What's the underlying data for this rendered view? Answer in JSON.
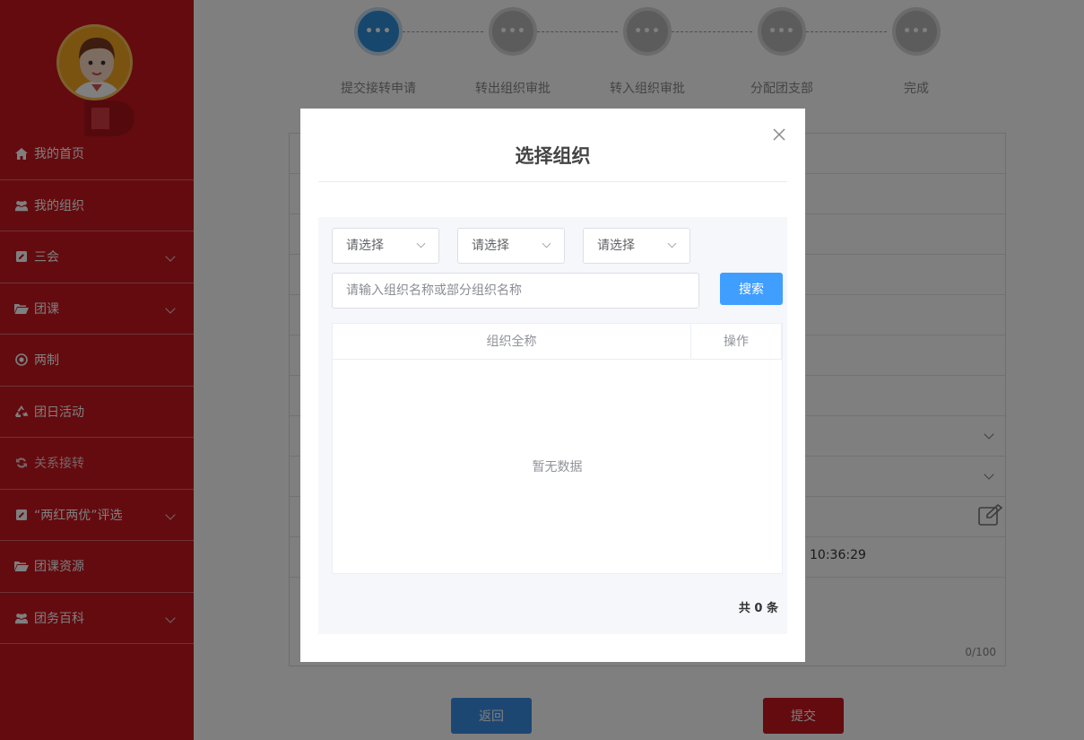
{
  "sidebar": {
    "items": [
      {
        "label": "我的首页",
        "icon": "home-icon",
        "has_submenu": false
      },
      {
        "label": "我的组织",
        "icon": "users-icon",
        "has_submenu": false
      },
      {
        "label": "三会",
        "icon": "edit-icon",
        "has_submenu": true
      },
      {
        "label": "团课",
        "icon": "folder-icon",
        "has_submenu": true
      },
      {
        "label": "两制",
        "icon": "target-icon",
        "has_submenu": false
      },
      {
        "label": "团日活动",
        "icon": "recycle-icon",
        "has_submenu": false
      },
      {
        "label": "关系接转",
        "icon": "refresh-icon",
        "has_submenu": false
      },
      {
        "label": "“两红两优”评选",
        "icon": "edit-icon",
        "has_submenu": true
      },
      {
        "label": "团课资源",
        "icon": "folder-icon",
        "has_submenu": false
      },
      {
        "label": "团务百科",
        "icon": "users-icon",
        "has_submenu": true
      }
    ]
  },
  "steps": {
    "items": [
      {
        "label": "提交接转申请",
        "icon": "•••"
      },
      {
        "label": "转出组织审批",
        "icon": "•••"
      },
      {
        "label": "转入组织审批",
        "icon": "•••"
      },
      {
        "label": "分配团支部",
        "icon": "•••"
      },
      {
        "label": "完成",
        "icon": "•••"
      }
    ]
  },
  "form": {
    "time_value": "10:36:29",
    "counter": "0/100",
    "back_label": "返回",
    "submit_label": "提交"
  },
  "modal": {
    "title": "选择组织",
    "select1": "请选择",
    "select2": "请选择",
    "select3": "请选择",
    "search_placeholder": "请输入组织名称或部分组织名称",
    "search_button": "搜索",
    "col_name": "组织全称",
    "col_action": "操作",
    "empty_text": "暂无数据",
    "total_text": "共 0 条"
  },
  "colors": {
    "sidebar_bg": "#c8171e",
    "primary_blue": "#409eff",
    "step_active": "#2f8fd8"
  }
}
